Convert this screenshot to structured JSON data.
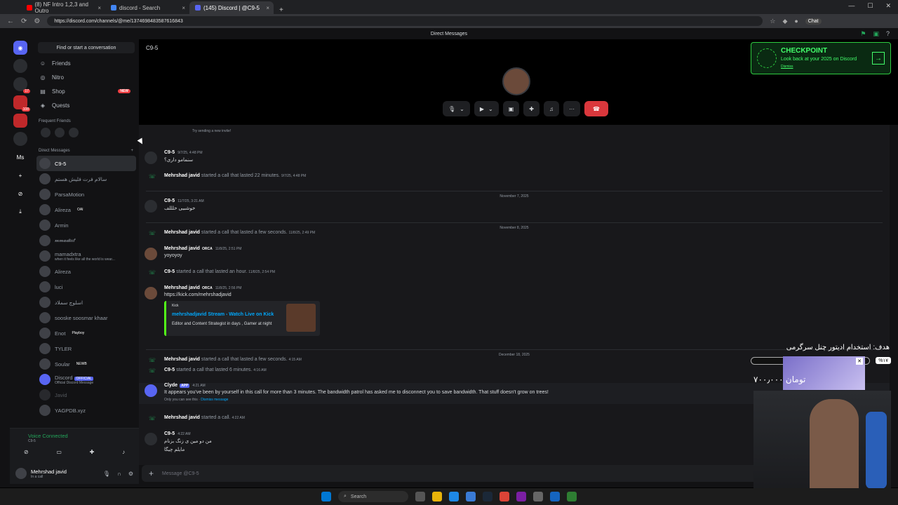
{
  "browser": {
    "tabs": [
      {
        "title": "(8) NF Intro 1,2,3 and Outro",
        "color": "#ff0000"
      },
      {
        "title": "discord - Search",
        "color": "#4285f4"
      },
      {
        "title": "(145) Discord | @C9-5",
        "color": "#5865f2"
      }
    ],
    "url": "https://discord.com/channels/@me/1374698483587616843",
    "chat_label": "Chat"
  },
  "discord": {
    "top_title": "Direct Messages",
    "find_placeholder": "Find or start a conversation",
    "nav": [
      {
        "label": "Friends",
        "icon": "friends-icon"
      },
      {
        "label": "Nitro",
        "icon": "nitro-icon"
      },
      {
        "label": "Shop",
        "icon": "shop-icon",
        "badge": "NEW"
      },
      {
        "label": "Quests",
        "icon": "quests-icon"
      }
    ],
    "frequent_friends_label": "Frequent Friends",
    "dm_header": "Direct Messages",
    "dms": [
      {
        "name": "C9-5",
        "active": true
      },
      {
        "name": "سالام فرت فلیش هستم"
      },
      {
        "name": "ParsaMotion"
      },
      {
        "name": "Alireza",
        "tag": "OAI"
      },
      {
        "name": "Armin"
      },
      {
        "name": "𝓂𝓂𝒶𝒹𝑒𝒾𝓉"
      },
      {
        "name": "mamadxtra",
        "sub": "when it feels like all the world is wear..."
      },
      {
        "name": "Alireza"
      },
      {
        "name": "luci"
      },
      {
        "name": "اسلوچ سملاد"
      },
      {
        "name": "sooske soosmar khaar"
      },
      {
        "name": "Enot",
        "tag": "Playboy"
      },
      {
        "name": "TYLER"
      },
      {
        "name": "Soular",
        "tag": "NEWB"
      },
      {
        "name": "Discord",
        "tag": "OFFICIAL",
        "sub": "Official Discord Message"
      },
      {
        "name": "Javid"
      },
      {
        "name": "YAGPDB.xyz"
      }
    ],
    "guild_badges": [
      "17",
      "108"
    ],
    "guild_ms": "Ms",
    "voice": {
      "status": "Voice Connected",
      "channel": "C9-5"
    },
    "user": {
      "name": "Mehrshad javid",
      "status": "In a call"
    },
    "call": {
      "title": "C9-5"
    },
    "checkpoint": {
      "title": "CHECKPOINT",
      "subtitle": "Look back at your 2025 on Discord",
      "dismiss": "Dismiss"
    },
    "messages": {
      "invite_hint": "Try sending a new invite!",
      "m1": {
        "author": "C9-5",
        "time": "9/7/25, 4:48 PM",
        "text": "سنمامو داری؟"
      },
      "s1": {
        "actor": "Mehrshad javid",
        "text": "started a call that lasted 22 minutes.",
        "time": "9/7/25, 4:48 PM"
      },
      "d1": "November 7, 2025",
      "m2": {
        "author": "C9-5",
        "time": "11/7/25, 3:21 AM",
        "text": "خوشبیی خلللف"
      },
      "d2": "November 8, 2025",
      "s2": {
        "actor": "Mehrshad javid",
        "text": "started a call that lasted a few seconds.",
        "time": "11/8/25, 2:49 PM"
      },
      "m3": {
        "author": "Mehrshad javid",
        "tag": "ORCA",
        "time": "11/8/25, 2:51 PM",
        "text": "yoyoyoy"
      },
      "s3": {
        "actor": "C9-5",
        "text": "started a call that lasted an hour.",
        "time": "11/8/25, 2:54 PM"
      },
      "m4": {
        "author": "Mehrshad javid",
        "tag": "ORCA",
        "time": "11/8/25, 2:56 PM",
        "text": "https://kick.com/mehrshadjavid"
      },
      "embed": {
        "provider": "Kick",
        "title": "mehrshadjavid Stream - Watch Live on Kick",
        "desc": "Editor and Content Strategist in days , Gamer at night"
      },
      "d3": "December 18, 2025",
      "s4": {
        "actor": "Mehrshad javid",
        "text": "started a call that lasted a few seconds.",
        "time": "4:15 AM"
      },
      "s5": {
        "actor": "C9-5",
        "text": "started a call that lasted 6 minutes.",
        "time": "4:16 AM"
      },
      "m5": {
        "author": "Clyde",
        "tag": "APP",
        "time": "4:21 AM",
        "text": "It appears you've been by yourself in this call for more than 3 minutes. The bandwidth patrol has asked me to disconnect you to save bandwidth. That stuff doesn't grow on trees!",
        "note": "Only you can see this ·",
        "dismiss": "Dismiss message"
      },
      "s6": {
        "actor": "Mehrshad javid",
        "text": "started a call.",
        "time": "4:22 AM"
      },
      "m6": {
        "author": "C9-5",
        "time": "4:22 AM",
        "text": "من دو مین ی زنگ بزنام",
        "text2": "مایلم چیگا"
      }
    },
    "composer_placeholder": "Message @C9-5"
  },
  "overlay": {
    "goal": "هدف: استخدام ادیتور چنل سرگرمی",
    "percent": "%۱۷",
    "amount": "۷۰۰٫۰۰۰ تومان"
  },
  "taskbar": {
    "search": "Search"
  }
}
